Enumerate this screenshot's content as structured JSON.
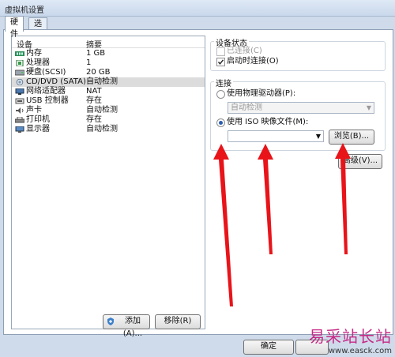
{
  "window": {
    "title": "虚拟机设置"
  },
  "tabs": [
    {
      "label": "硬件"
    },
    {
      "label": "选项"
    }
  ],
  "device_list": {
    "headers": {
      "device": "设备",
      "summary": "摘要"
    },
    "rows": [
      {
        "name": "内存",
        "value": "1 GB",
        "icon": "memory-icon"
      },
      {
        "name": "处理器",
        "value": "1",
        "icon": "processor-icon"
      },
      {
        "name": "硬盘(SCSI)",
        "value": "20 GB",
        "icon": "harddisk-icon"
      },
      {
        "name": "CD/DVD (SATA)",
        "value": "自动检测",
        "icon": "cd-dvd-icon"
      },
      {
        "name": "网络适配器",
        "value": "NAT",
        "icon": "network-adapter-icon"
      },
      {
        "name": "USB 控制器",
        "value": "存在",
        "icon": "usb-icon"
      },
      {
        "name": "声卡",
        "value": "自动检测",
        "icon": "sound-card-icon"
      },
      {
        "name": "打印机",
        "value": "存在",
        "icon": "printer-icon"
      },
      {
        "name": "显示器",
        "value": "自动检测",
        "icon": "display-icon"
      }
    ],
    "selected_index": 3
  },
  "buttons": {
    "add": "添加(A)...",
    "remove": "移除(R)",
    "ok": "确定",
    "browse": "浏览(B)...",
    "advanced": "高级(V)..."
  },
  "device_status": {
    "title": "设备状态",
    "connected": {
      "label": "已连接(C)",
      "checked": false,
      "enabled": false
    },
    "connect_on_start": {
      "label": "启动时连接(O)",
      "checked": true
    }
  },
  "connection": {
    "title": "连接",
    "physical_drive": {
      "label": "使用物理驱动器(P):",
      "selected": false,
      "combo_value": "自动检测"
    },
    "iso_file": {
      "label": "使用 ISO 映像文件(M):",
      "selected": true,
      "value": ""
    }
  },
  "colors": {
    "arrow": "#e8141a",
    "selection": "#dcdcdc",
    "watermark": "#c62a86"
  },
  "watermark": {
    "line1": "易采站长站",
    "line2": "www.easck.com"
  }
}
